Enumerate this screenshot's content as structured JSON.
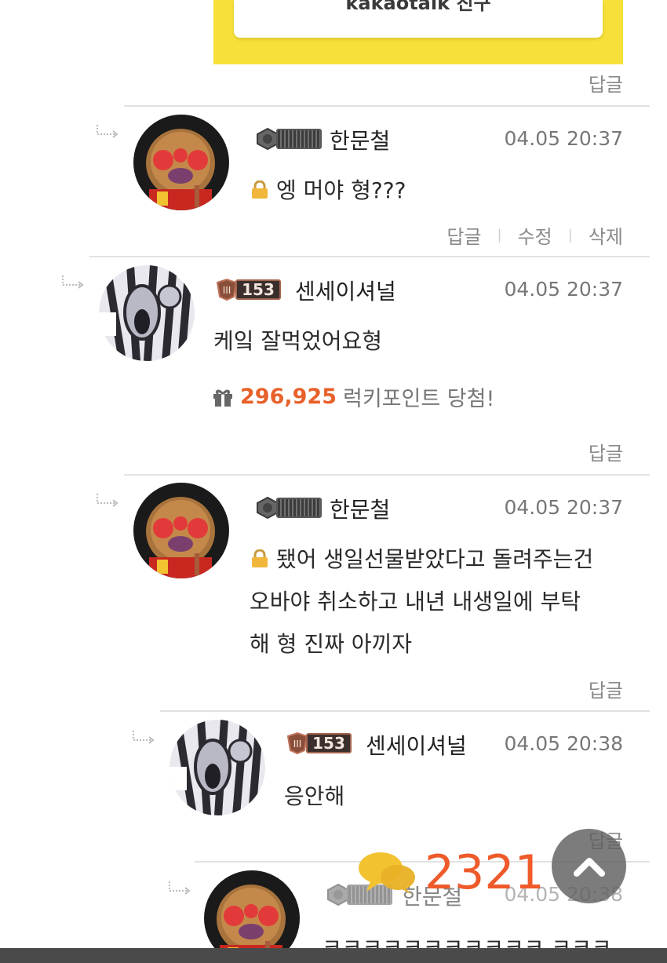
{
  "banner": {
    "text": "kakaotalk 친구"
  },
  "common": {
    "reply_label": "답글",
    "edit_label": "수정",
    "delete_label": "삭제"
  },
  "comments": [
    {
      "nick": "한문철",
      "time": "04.05 20:37",
      "lines": [
        "엥 머야 형???"
      ],
      "secret": true
    },
    {
      "nick": "센세이셔널",
      "level": "153",
      "time": "04.05 20:37",
      "lines": [
        "케잌 잘먹었어요형"
      ]
    },
    {
      "nick": "한문철",
      "time": "04.05 20:37",
      "lines": [
        "됐어 생일선물받았다고 돌려주는건",
        "오바야 취소하고 내년 내생일에 부탁",
        "해 형 진짜 아끼자"
      ],
      "secret": true
    },
    {
      "nick": "센세이셔널",
      "level": "153",
      "time": "04.05 20:38",
      "lines": [
        "응안해"
      ]
    },
    {
      "nick": "한문철",
      "time": "04.05 20:38",
      "lines": [
        "ㅋㅋㅋㅋㅋㅋㅋㅋㅋㅋㅋ ㅋㅋㅋ"
      ]
    }
  ],
  "lucky": {
    "amount": "296,925",
    "text": "럭키포인트 당첨!"
  },
  "comment_count": "2321",
  "colors": {
    "accent": "#ef5a2a",
    "kakao_yellow": "#f7e03a"
  },
  "icons": [
    "reply-arrow-icon",
    "lock-icon",
    "gift-icon",
    "chat-bubbles-icon",
    "chevron-up-icon"
  ]
}
